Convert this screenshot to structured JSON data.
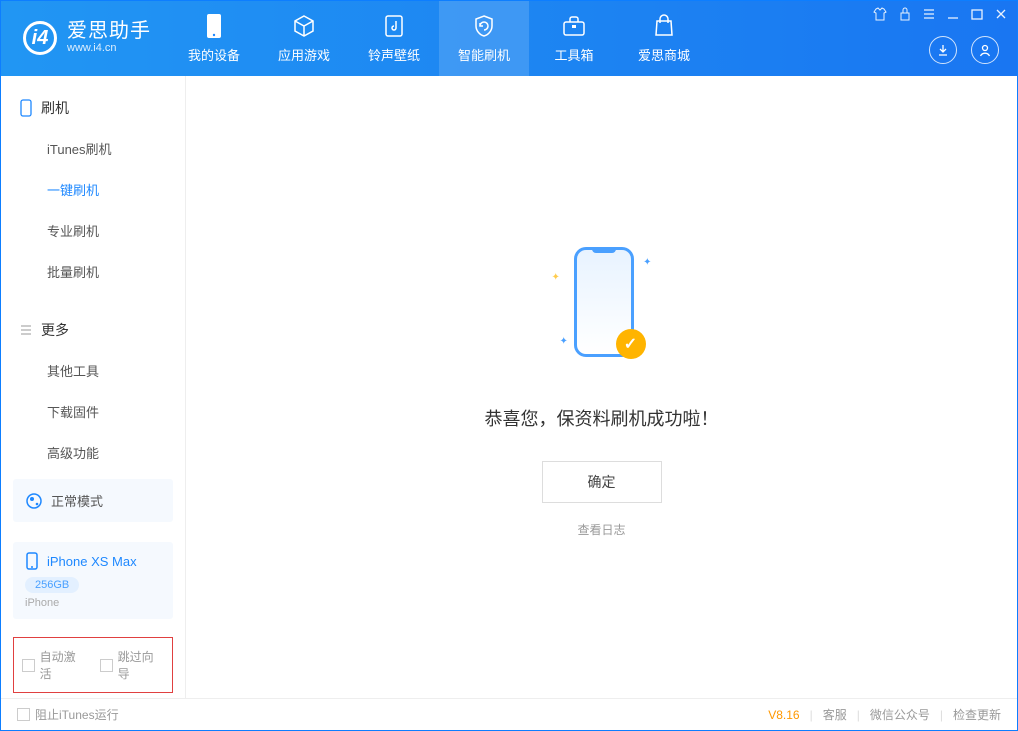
{
  "app": {
    "title": "爱思助手",
    "subtitle": "www.i4.cn"
  },
  "tabs": [
    {
      "label": "我的设备"
    },
    {
      "label": "应用游戏"
    },
    {
      "label": "铃声壁纸"
    },
    {
      "label": "智能刷机"
    },
    {
      "label": "工具箱"
    },
    {
      "label": "爱思商城"
    }
  ],
  "sidebar": {
    "section1": {
      "title": "刷机",
      "items": [
        "iTunes刷机",
        "一键刷机",
        "专业刷机",
        "批量刷机"
      ]
    },
    "section2": {
      "title": "更多",
      "items": [
        "其他工具",
        "下载固件",
        "高级功能"
      ]
    }
  },
  "mode": {
    "label": "正常模式"
  },
  "device": {
    "name": "iPhone XS Max",
    "capacity": "256GB",
    "type": "iPhone"
  },
  "options": {
    "auto_activate": "自动激活",
    "skip_guide": "跳过向导"
  },
  "main": {
    "message": "恭喜您，保资料刷机成功啦！",
    "ok_button": "确定",
    "view_log": "查看日志"
  },
  "footer": {
    "block_itunes": "阻止iTunes运行",
    "version": "V8.16",
    "links": [
      "客服",
      "微信公众号",
      "检查更新"
    ]
  }
}
